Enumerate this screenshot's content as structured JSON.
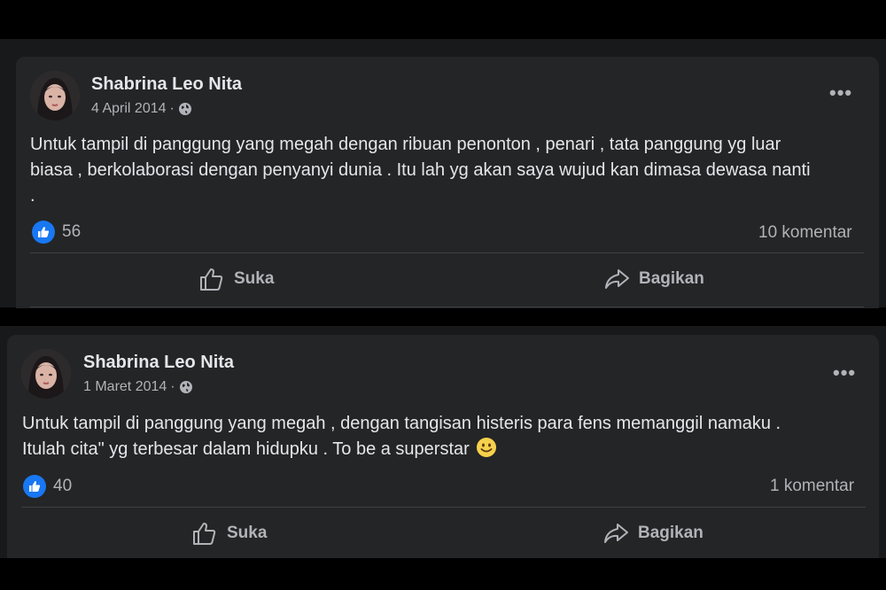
{
  "colors": {
    "card_bg": "#242526",
    "page_bg": "#000000",
    "text_primary": "#e4e6eb",
    "text_secondary": "#b0b3b8",
    "like_blue": "#1877f2"
  },
  "posts": [
    {
      "author": "Shabrina Leo Nita",
      "date": "4 April 2014",
      "separator": "·",
      "privacy_icon": "globe-icon",
      "lines": [
        "Untuk tampil di panggung yang megah dengan ribuan penonton , penari , tata panggung yg luar",
        "biasa , berkolaborasi dengan penyanyi dunia . Itu lah yg akan saya wujud kan dimasa dewasa nanti",
        "."
      ],
      "like_count": "56",
      "comment_count": "10 komentar",
      "like_label": "Suka",
      "share_label": "Bagikan"
    },
    {
      "author": "Shabrina Leo Nita",
      "date": "1 Maret 2014",
      "separator": "·",
      "privacy_icon": "globe-icon",
      "lines": [
        "Untuk tampil di panggung yang megah , dengan tangisan histeris  para fens memanggil namaku .",
        "Itulah cita\" yg terbesar dalam hidupku . To be a superstar"
      ],
      "emoji": "smiley-emoji",
      "like_count": "40",
      "comment_count": "1 komentar",
      "like_label": "Suka",
      "share_label": "Bagikan"
    }
  ]
}
